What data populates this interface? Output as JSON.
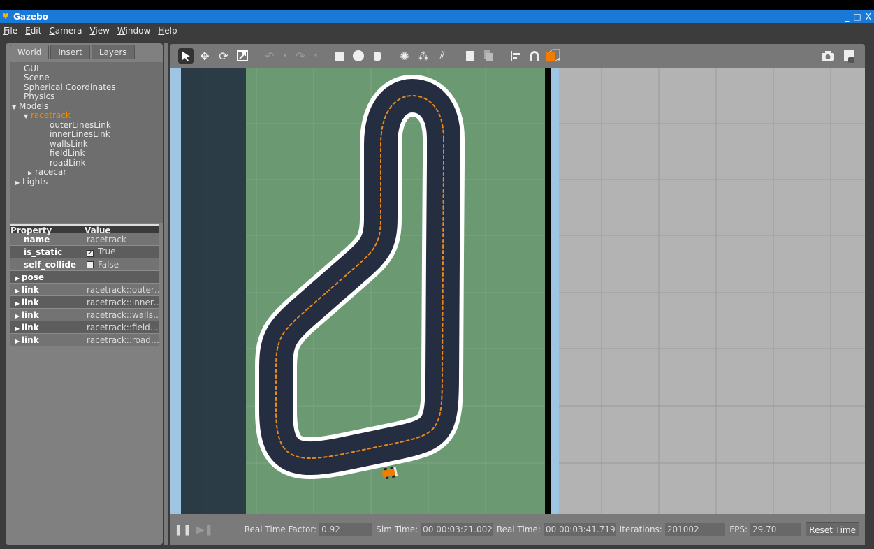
{
  "window": {
    "title": "Gazebo",
    "controls": [
      "_",
      "□",
      "X"
    ]
  },
  "menu": [
    {
      "label": "File",
      "key": "F",
      "rest": "ile"
    },
    {
      "label": "Edit",
      "key": "E",
      "rest": "dit"
    },
    {
      "label": "Camera",
      "key": "C",
      "rest": "amera"
    },
    {
      "label": "View",
      "key": "V",
      "rest": "iew"
    },
    {
      "label": "Window",
      "key": "W",
      "rest": "indow"
    },
    {
      "label": "Help",
      "key": "H",
      "rest": "elp"
    }
  ],
  "tabs": {
    "world": "World",
    "insert": "Insert",
    "layers": "Layers",
    "active": "World"
  },
  "tree": {
    "gui": "GUI",
    "scene": "Scene",
    "spherical": "Spherical Coordinates",
    "physics": "Physics",
    "models": "Models",
    "racetrack": "racetrack",
    "outer": "outerLinesLink",
    "inner": "innerLinesLink",
    "walls": "wallsLink",
    "field": "fieldLink",
    "road": "roadLink",
    "racecar": "racecar",
    "lights": "Lights"
  },
  "properties": {
    "header": {
      "property": "Property",
      "value": "Value"
    },
    "name": {
      "key": "name",
      "value": "racetrack"
    },
    "is_static": {
      "key": "is_static",
      "value": "True",
      "checked": true
    },
    "self_collide": {
      "key": "self_collide",
      "value": "False",
      "checked": false
    },
    "pose": {
      "key": "pose"
    },
    "links": [
      {
        "key": "link",
        "value": "racetrack::outer…"
      },
      {
        "key": "link",
        "value": "racetrack::inner…"
      },
      {
        "key": "link",
        "value": "racetrack::walls…"
      },
      {
        "key": "link",
        "value": "racetrack::field…"
      },
      {
        "key": "link",
        "value": "racetrack::road…"
      }
    ]
  },
  "status": {
    "rtf_label": "Real Time Factor:",
    "rtf": "0.92",
    "sim_label": "Sim Time:",
    "sim": "00 00:03:21.002",
    "real_label": "Real Time:",
    "real": "00 00:03:41.719",
    "iter_label": "Iterations:",
    "iter": "201002",
    "fps_label": "FPS:",
    "fps": "29.70",
    "reset": "Reset Time"
  },
  "colors": {
    "titlebar": "#1a78d6",
    "selected": "#f08a00",
    "grass": "#6b9a72",
    "road": "#252d40",
    "centerline": "#e8891c"
  }
}
